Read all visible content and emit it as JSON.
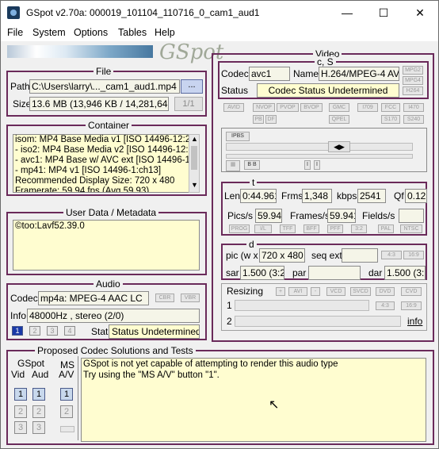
{
  "window": {
    "title": "GSpot v2.70a: 000019_101104_110716_0_cam1_aud1"
  },
  "menu": [
    "File",
    "System",
    "Options",
    "Tables",
    "Help"
  ],
  "logo_text": "GSpot",
  "file": {
    "title": "File",
    "path_label": "Path",
    "path_value": "C:\\Users\\larry\\..._cam1_aud1.mp4",
    "browse_label": "...",
    "size_label": "Size",
    "size_value": "13.6 MB (13,946 KB / 14,281,647 b",
    "page": "1/1"
  },
  "container": {
    "title": "Container",
    "lines": [
      "isom: MP4  Base Media v1 [ISO 14496-12:200",
      "- iso2: MP4 Base Media v2 [ISO 14496-12:200",
      "- avc1: MP4 Base w/ AVC ext [ISO 14496-12:",
      "- mp41: MP4 v1 [ISO 14496-1:ch13]",
      "Recommended Display Size: 720 x 480",
      "Framerate: 59.94 fps (Avg 59.93)"
    ]
  },
  "userdata": {
    "title": "User Data / Metadata",
    "value": "©too:Lavf52.39.0"
  },
  "audio": {
    "title": "Audio",
    "codec_label": "Codec",
    "codec_value": "mp4a: MPEG-4 AAC LC",
    "cbr": "CBR",
    "vbr": "VBR",
    "info_label": "Info",
    "info_value": "48000Hz , stereo (2/0)",
    "streams": [
      "1",
      "2",
      "3",
      "4"
    ],
    "stat_label": "Stat",
    "stat_value": "Status Undetermined"
  },
  "video": {
    "title": "Video",
    "cs": "c, S",
    "codec_label": "Codec",
    "codec_value": "avc1",
    "name_label": "Name",
    "name_value": "H.264/MPEG-4 AVC",
    "mpg_tags": [
      "MPG2",
      "MPG4",
      "H264"
    ],
    "status_label": "Status",
    "status_value": "Codec Status Undetermined",
    "tags_row1": [
      "AVID",
      "NVOP",
      "PVOP",
      "BVOP",
      "GMC",
      "I709",
      "FCC",
      "I470"
    ],
    "tags_row2": [
      "PB",
      "DF",
      "QPEL",
      "S170",
      "S240"
    ],
    "t_label": "t",
    "len_label": "Len",
    "len_value": "0:44.961",
    "frms_label": "Frms",
    "frms_value": "1,348",
    "kbps_label": "kbps",
    "kbps_value": "2541",
    "qf_label": "Qf",
    "qf_value": "0.123",
    "pics_label": "Pics/s",
    "pics_value": "59.941",
    "frames_label": "Frames/s",
    "frames_value": "59.941",
    "fields_label": "Fields/s",
    "fields_value": "",
    "tags_row3": [
      "PROG",
      "I/L",
      "TFF",
      "BFF",
      "PFF",
      "3:2",
      "PAL",
      "NTSC"
    ],
    "d_label": "d",
    "pic_label": "pic (w x",
    "pic_value": "720 x 480",
    "seq_label": "seq ext",
    "ar43": "4:3",
    "ar169": "16:9",
    "sar_label": "sar",
    "sar_value": "1.500 (3:2)",
    "par_label": "par",
    "par_value": "",
    "dar_label": "dar",
    "dar_value": "1.500 (3:2)",
    "resizing_label": "Resizing",
    "resize_btns": [
      "+",
      "AVI",
      "-",
      "VCD",
      "SVCD",
      "DVD",
      "CVD"
    ],
    "row1": "1",
    "row2": "2",
    "info_link": "info"
  },
  "proposed": {
    "title": "Proposed Codec Solutions and Tests",
    "gspot_label": "GSpot",
    "vid_label": "Vid",
    "aud_label": "Aud",
    "ms_label": "MS",
    "av_label": "A/V",
    "nums": [
      "1",
      "2",
      "3"
    ],
    "message_lines": [
      "GSpot is not yet capable of attempting to render this audio type",
      "Try using the \"MS A/V\" button \"1\"."
    ]
  }
}
